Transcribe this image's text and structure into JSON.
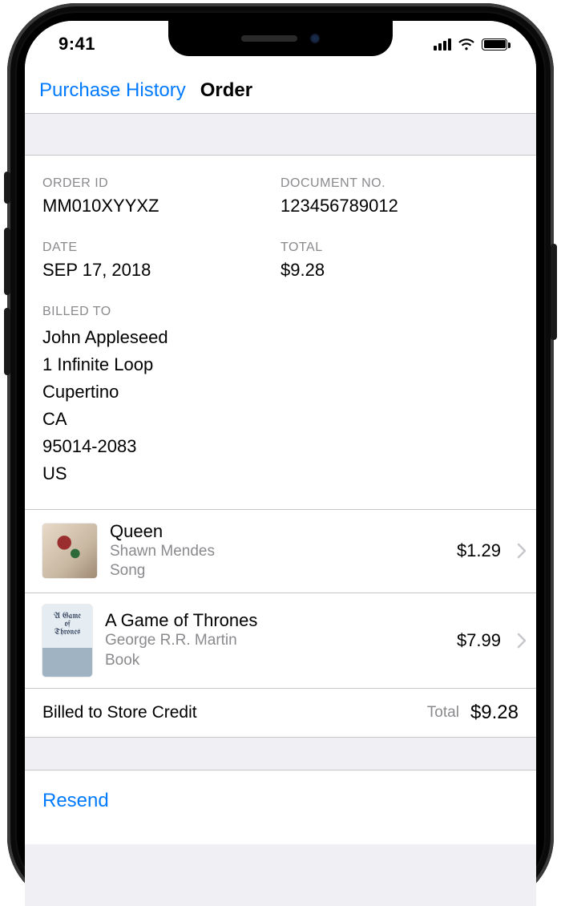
{
  "status": {
    "time": "9:41"
  },
  "nav": {
    "back": "Purchase History",
    "title": "Order"
  },
  "order": {
    "labels": {
      "order_id": "ORDER ID",
      "document_no": "DOCUMENT NO.",
      "date": "DATE",
      "total": "TOTAL",
      "billed_to": "BILLED TO"
    },
    "order_id": "MM010XYYXZ",
    "document_no": "123456789012",
    "date": "SEP 17, 2018",
    "total": "$9.28",
    "billing": {
      "name": "John Appleseed",
      "street": "1 Infinite Loop",
      "city": "Cupertino",
      "state": "CA",
      "zip": "95014-2083",
      "country": "US"
    }
  },
  "items": [
    {
      "title": "Queen",
      "subtitle": "Shawn Mendes",
      "kind": "Song",
      "price": "$1.29",
      "art": "song"
    },
    {
      "title": "A Game of Thrones",
      "subtitle": "George R.R. Martin",
      "kind": "Book",
      "price": "$7.99",
      "art": "book"
    }
  ],
  "totals": {
    "payment_method": "Billed to Store Credit",
    "total_label": "Total",
    "total_value": "$9.28"
  },
  "actions": {
    "resend": "Resend"
  }
}
